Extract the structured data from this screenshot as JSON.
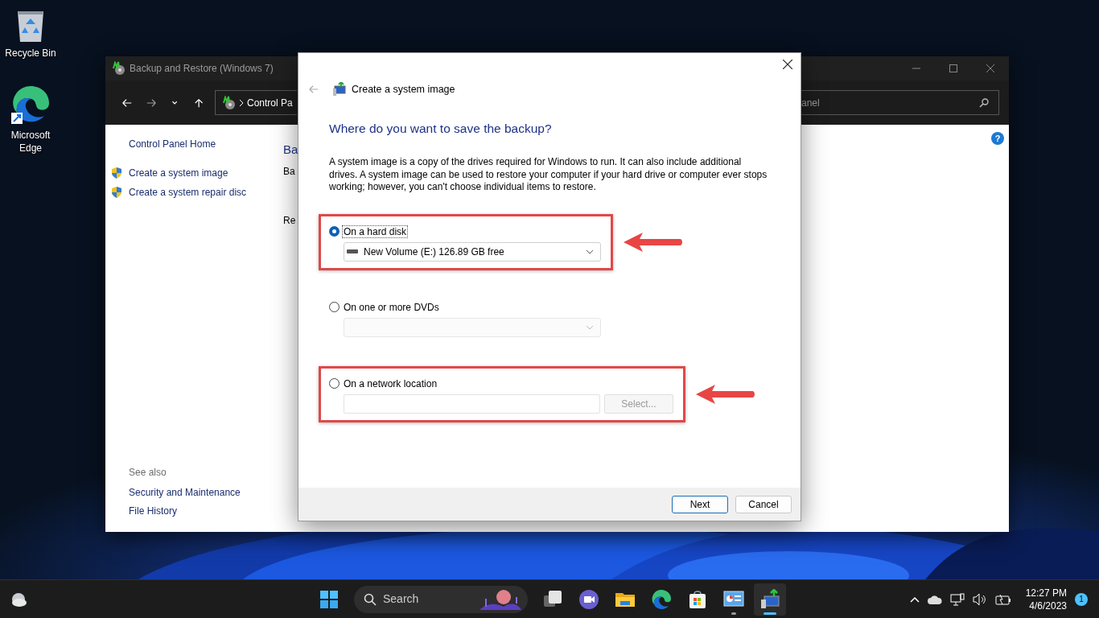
{
  "desktop_icons": [
    {
      "kind": "recycle-bin",
      "label": "Recycle Bin"
    },
    {
      "kind": "edge",
      "label": "Microsoft Edge"
    }
  ],
  "background_window": {
    "title": "Backup and Restore (Windows 7)",
    "address": "Control Pa",
    "search": "anel",
    "help": "?",
    "sidebar_links": [
      {
        "label": "Control Panel Home",
        "shield": false
      },
      {
        "label": "Create a system image",
        "shield": true
      },
      {
        "label": "Create a system repair disc",
        "shield": true
      }
    ],
    "see_also_heading": "See also",
    "see_also": [
      "Security and Maintenance",
      "File History"
    ],
    "content_fragments": [
      {
        "kind": "heading",
        "text": "Ba"
      },
      {
        "kind": "text",
        "text": "Ba"
      },
      {
        "kind": "text",
        "text": "Re"
      }
    ]
  },
  "dialog": {
    "title": "Create a system image",
    "heading": "Where do you want to save the backup?",
    "description": "A system image is a copy of the drives required for Windows to run. It can also include additional drives. A system image can be used to restore your computer if your hard drive or computer ever stops working; however, you can't choose individual items to restore.",
    "options": [
      {
        "kind": "dropdown",
        "label": "On a hard disk",
        "selected": true,
        "disabled": false,
        "highlighted": true,
        "value": "New Volume (E:)  126.89 GB free"
      },
      {
        "kind": "dropdown",
        "label": "On one or more DVDs",
        "selected": false,
        "disabled": true,
        "highlighted": false
      },
      {
        "kind": "path",
        "label": "On a network location",
        "selected": false,
        "disabled": true,
        "highlighted": true,
        "button": "Select..."
      }
    ],
    "buttons": [
      {
        "label": "Next",
        "default": true
      },
      {
        "label": "Cancel",
        "default": false
      }
    ]
  },
  "taskbar": {
    "search_placeholder": "Search",
    "apps": [
      {
        "kind": "task-view",
        "running": false,
        "active": false
      },
      {
        "kind": "meet",
        "running": false,
        "active": false
      },
      {
        "kind": "explorer",
        "running": false,
        "active": false
      },
      {
        "kind": "edge",
        "running": false,
        "active": false
      },
      {
        "kind": "store",
        "running": false,
        "active": false
      },
      {
        "kind": "control-panel",
        "running": true,
        "active": false
      },
      {
        "kind": "backup",
        "running": true,
        "active": true
      }
    ],
    "time": "12:27 PM",
    "date": "4/6/2023",
    "notifications": "1"
  }
}
